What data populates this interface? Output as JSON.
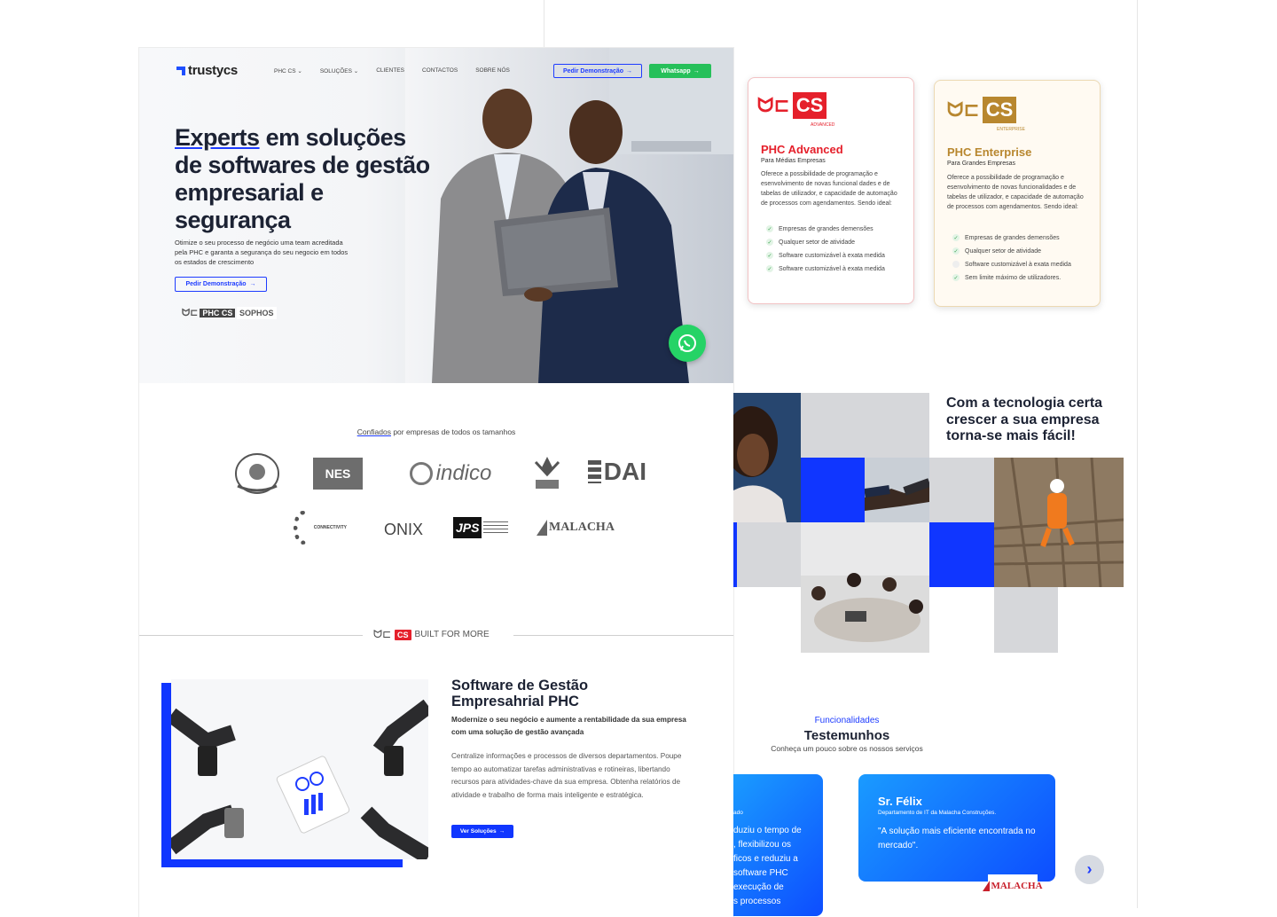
{
  "nav": {
    "logo": "trustycs",
    "links": [
      "PHC CS ⌄",
      "SOLUÇÕES ⌄",
      "CLIENTES",
      "CONTACTOS",
      "SOBRE NÓS"
    ],
    "demo_label": "Pedir Demonstração",
    "whatsapp_label": "Whatsapp"
  },
  "hero": {
    "title_underlined": "Experts",
    "title_rest": " em soluções de softwares de gestão empresarial e segurança",
    "subtitle": "Otimize o seu processo de negócio uma team acreditada pela PHC e garanta a segurança do seu negocio em todos os estados de crescimento",
    "cta_label": "Pedir Demonstração",
    "partners": [
      "PHC CS",
      "SOPHOS"
    ]
  },
  "trusted": {
    "underlined": "Confiados",
    "rest": " por empresas de todos os tamanhos",
    "clients": [
      "indico",
      "DAI",
      "ONIX",
      "JPS",
      "MALACHA",
      "CONNECTIVITY",
      "NES"
    ]
  },
  "built": {
    "brand": "CS",
    "tagline": "BUILT FOR MORE"
  },
  "software": {
    "title": "Software de Gestão Empresahrial PHC",
    "lead": "Modernize o seu negócio e aumente a rentabilidade da sua empresa com uma solução de gestão avançada",
    "body": "Centralize informações e processos de diversos departamentos. Poupe tempo ao automatizar tarefas administrativas e rotineiras, libertando recursos para atividades-chave da sua empresa. Obtenha relatórios de atividade e trabalho de forma mais inteligente e estratégica.",
    "button": "Ver Soluções"
  },
  "advanced": {
    "badge": "ADVANCED",
    "title": "PHC Advanced",
    "subtitle": "Para Médias Empresas",
    "desc": "Oferece a possibilidade de programação e esenvolvimento de novas funcional dades e de tabelas de utilizador, e capacidade de automação de processos com agendamentos. Sendo ideal:",
    "features": [
      "Empresas de grandes demensões",
      "Qualquer setor de atividade",
      "Software customizável à exata medida",
      "Software customizável à exata medida"
    ]
  },
  "enterprise": {
    "badge": "ENTERPRISE",
    "title": "PHC Enterprise",
    "subtitle": "Para Grandes Empresas",
    "desc": "Oferece a possibilidade de programação e esenvolvimento de novas funcionalidades e de tabelas de utilizador, e capacidade de automação de processos com agendamentos. Sendo ideal:",
    "features": [
      "Empresas de grandes demensões",
      "Qualquer setor de atividade",
      "Software customizável à exata medida",
      "Sem limite máximo de utilizadores."
    ]
  },
  "cta": {
    "title": "Com a tecnologia certa crescer a sua empresa torna-se mais fácil!"
  },
  "testimonials": {
    "kicker": "Funcionalidades",
    "title": "Testemunhos",
    "subtitle": "Conheça um pouco sobre os nossos serviços",
    "partial": {
      "role": "ado",
      "lines": [
        "duziu o tempo de",
        ", flexibilizou os",
        "ficos e reduziu a",
        "software PHC",
        "execução de",
        "s processos"
      ]
    },
    "main": {
      "name": "Sr. Félix",
      "role": "Departamento de IT da Malacha Construções.",
      "quote": "\"A solução mais eficiente encontrada no mercado\".",
      "logo": "MALACHA"
    },
    "next": "›"
  },
  "colors": {
    "accent": "#1e3cff",
    "green": "#26c05a",
    "phc_red": "#e5202b",
    "enterprise_gold": "#b8872f"
  }
}
